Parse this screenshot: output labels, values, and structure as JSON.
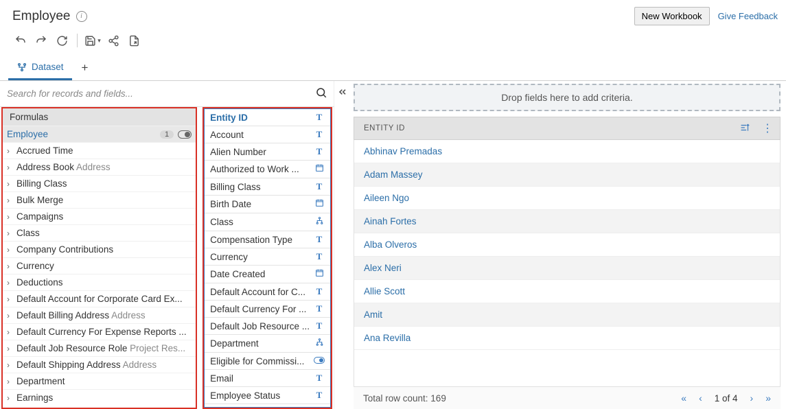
{
  "header": {
    "title": "Employee",
    "new_workbook": "New Workbook",
    "feedback": "Give Feedback"
  },
  "tabs": {
    "dataset": "Dataset"
  },
  "search": {
    "placeholder": "Search for records and fields..."
  },
  "panel1": {
    "formulas_header": "Formulas",
    "employee_label": "Employee",
    "employee_count": "1",
    "items": [
      {
        "label": "Accrued Time"
      },
      {
        "label": "Address Book",
        "sub": "Address"
      },
      {
        "label": "Billing Class"
      },
      {
        "label": "Bulk Merge"
      },
      {
        "label": "Campaigns"
      },
      {
        "label": "Class"
      },
      {
        "label": "Company Contributions"
      },
      {
        "label": "Currency"
      },
      {
        "label": "Deductions"
      },
      {
        "label": "Default Account for Corporate Card Ex..."
      },
      {
        "label": "Default Billing Address",
        "sub": "Address"
      },
      {
        "label": "Default Currency For Expense Reports ..."
      },
      {
        "label": "Default Job Resource Role",
        "sub": "Project Res..."
      },
      {
        "label": "Default Shipping Address",
        "sub": "Address"
      },
      {
        "label": "Department"
      },
      {
        "label": "Earnings"
      }
    ]
  },
  "panel2": {
    "items": [
      {
        "label": "Entity ID",
        "type": "T",
        "selected": true
      },
      {
        "label": "Account",
        "type": "T"
      },
      {
        "label": "Alien Number",
        "type": "T"
      },
      {
        "label": "Authorized to Work ...",
        "type": "cal"
      },
      {
        "label": "Billing Class",
        "type": "T"
      },
      {
        "label": "Birth Date",
        "type": "cal"
      },
      {
        "label": "Class",
        "type": "hier"
      },
      {
        "label": "Compensation Type",
        "type": "T"
      },
      {
        "label": "Currency",
        "type": "T"
      },
      {
        "label": "Date Created",
        "type": "cal"
      },
      {
        "label": "Default Account for C...",
        "type": "T"
      },
      {
        "label": "Default Currency For ...",
        "type": "T"
      },
      {
        "label": "Default Job Resource ...",
        "type": "T"
      },
      {
        "label": "Department",
        "type": "hier"
      },
      {
        "label": "Eligible for Commissi...",
        "type": "toggle"
      },
      {
        "label": "Email",
        "type": "T"
      },
      {
        "label": "Employee Status",
        "type": "T"
      }
    ]
  },
  "dropzone": "Drop fields here to add criteria.",
  "grid": {
    "column": "ENTITY ID",
    "rows": [
      "Abhinav Premadas",
      "Adam Massey",
      "Aileen Ngo",
      "Ainah Fortes",
      "Alba Olveros",
      "Alex Neri",
      "Allie Scott",
      "Amit",
      "Ana Revilla"
    ],
    "total_label": "Total row count: 169",
    "page_label": "1 of 4"
  }
}
